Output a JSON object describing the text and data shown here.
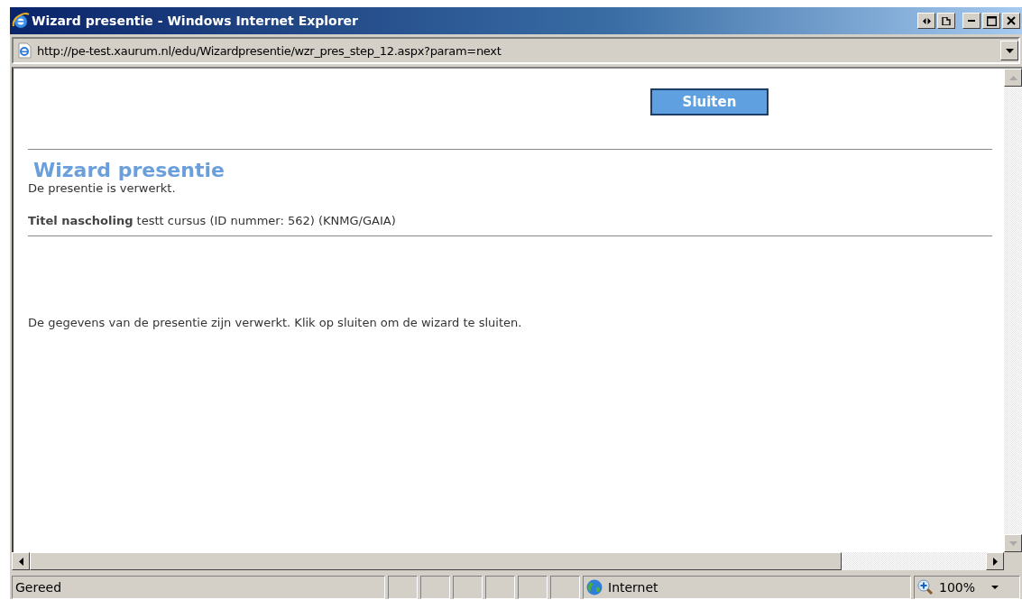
{
  "window": {
    "title": "Wizard presentie - Windows Internet Explorer"
  },
  "address_bar": {
    "url": "http://pe-test.xaurum.nl/edu/Wizardpresentie/wzr_pres_step_12.aspx?param=next"
  },
  "page": {
    "close_button": "Sluiten",
    "heading": "Wizard presentie",
    "status_text": "De presentie is verwerkt.",
    "course_line": "**Titel nascholing** testt cursus (ID nummer: 562) (KNMG/GAIA)",
    "message": "De gegevens van de presentie zijn verwerkt. Klik op sluiten om de wizard te sluiten."
  },
  "status_bar": {
    "text": "Gereed",
    "zone": "Internet",
    "zoom": "100%"
  }
}
